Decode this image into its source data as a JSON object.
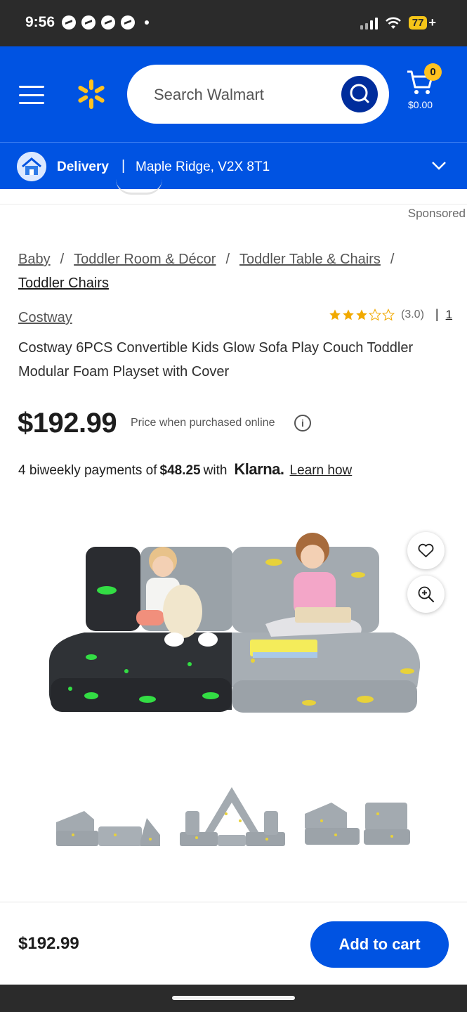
{
  "status_bar": {
    "time": "9:56",
    "battery": "77",
    "battery_plus": "+"
  },
  "header": {
    "search_placeholder": "Search Walmart",
    "cart_count": "0",
    "cart_total": "$0.00",
    "brand_color": "#0053e2",
    "spark_color": "#ffc220"
  },
  "delivery": {
    "label": "Delivery",
    "separator": "|",
    "location": "Maple Ridge, V2X 8T1"
  },
  "sponsored": "Sponsored",
  "breadcrumb": {
    "items": [
      "Baby",
      "Toddler Room & Décor",
      "Toddler Table & Chairs",
      "Toddler Chairs"
    ],
    "separator": "/"
  },
  "product": {
    "brand": "Costway",
    "rating_value": 3.0,
    "rating_max": 5,
    "rating_text": "(3.0)",
    "rating_separator": "|",
    "review_count": "1",
    "title": "Costway 6PCS Convertible Kids Glow Sofa Play Couch Toddler Modular Foam Playset with Cover",
    "price": "$192.99",
    "price_note": "Price when purchased online",
    "info_icon": "i"
  },
  "klarna": {
    "prefix": "4 biweekly payments of",
    "amount": "$48.25",
    "with": "with",
    "logo": "Klarna.",
    "link": "Learn how"
  },
  "icons": {
    "favorite": "heart-icon",
    "zoom": "zoom-in-icon",
    "search": "search-icon",
    "cart": "cart-icon",
    "menu": "menu-icon"
  },
  "bottom_bar": {
    "price": "$192.99",
    "add_to_cart": "Add to cart"
  }
}
